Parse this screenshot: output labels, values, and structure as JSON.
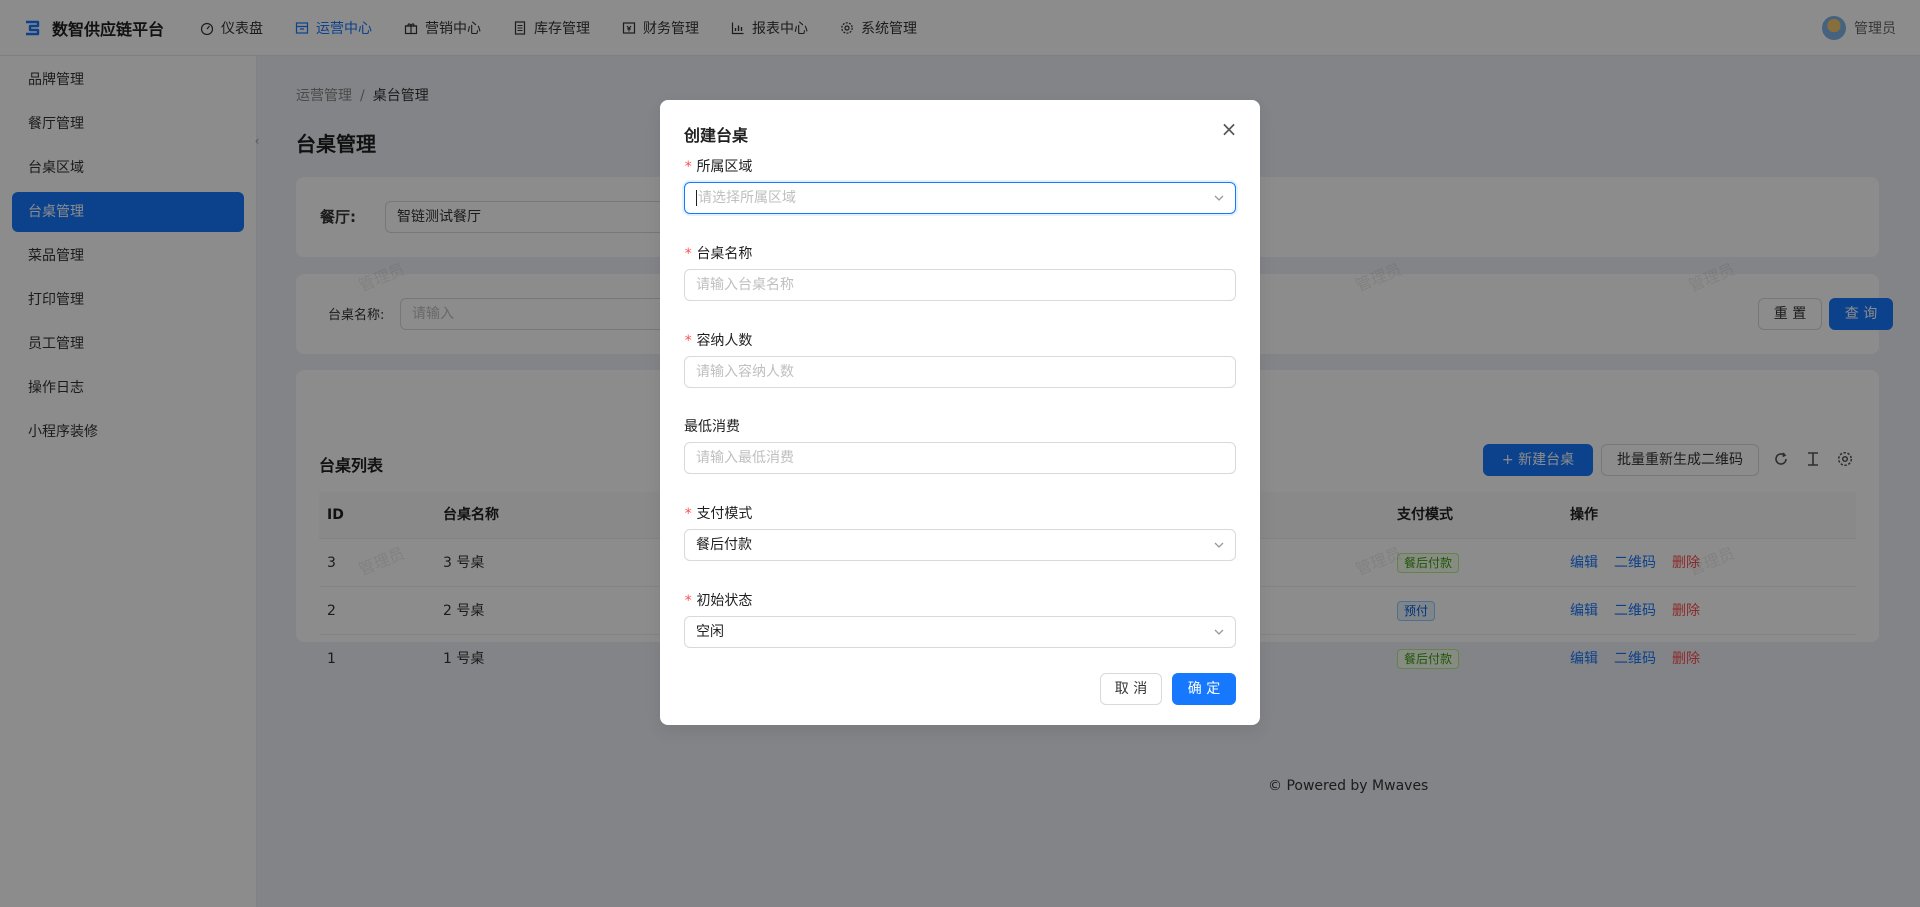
{
  "app": {
    "title": "数智供应链平台",
    "user": "管理员"
  },
  "nav": {
    "items": [
      {
        "label": "仪表盘",
        "icon": "dashboard-icon"
      },
      {
        "label": "运营中心",
        "icon": "shop-icon"
      },
      {
        "label": "营销中心",
        "icon": "gift-icon"
      },
      {
        "label": "库存管理",
        "icon": "file-icon"
      },
      {
        "label": "财务管理",
        "icon": "wallet-icon"
      },
      {
        "label": "报表中心",
        "icon": "chart-icon"
      },
      {
        "label": "系统管理",
        "icon": "gear-icon"
      }
    ],
    "active_index": 1
  },
  "sidebar": {
    "items": [
      {
        "label": "品牌管理"
      },
      {
        "label": "餐厅管理"
      },
      {
        "label": "台桌区域"
      },
      {
        "label": "台桌管理"
      },
      {
        "label": "菜品管理"
      },
      {
        "label": "打印管理"
      },
      {
        "label": "员工管理"
      },
      {
        "label": "操作日志"
      },
      {
        "label": "小程序装修"
      }
    ],
    "active_index": 3
  },
  "breadcrumb": {
    "parent": "运营管理",
    "separator": "/",
    "current": "桌台管理"
  },
  "page": {
    "title": "台桌管理",
    "restaurant_label": "餐厅:",
    "restaurant_value": "智链测试餐厅",
    "search_label": "台桌名称:",
    "search_placeholder": "请输入",
    "reset_button": "重 置",
    "query_button": "查 询",
    "watermark": "管理员",
    "footer": "Powered by Mwaves"
  },
  "table": {
    "title": "台桌列表",
    "new_button": "新建台桌",
    "regen_button": "批量重新生成二维码",
    "columns": [
      "ID",
      "台桌名称",
      "支付模式",
      "操作"
    ],
    "rows": [
      {
        "id": "3",
        "name": "3 号桌",
        "pay_mode": "餐后付款",
        "pay_color": "green"
      },
      {
        "id": "2",
        "name": "2 号桌",
        "pay_mode": "预付",
        "pay_color": "blue"
      },
      {
        "id": "1",
        "name": "1 号桌",
        "pay_mode": "餐后付款",
        "pay_color": "green"
      }
    ],
    "actions": {
      "edit": "编辑",
      "qrcode": "二维码",
      "delete": "删除"
    }
  },
  "modal": {
    "title": "创建台桌",
    "fields": {
      "area": {
        "label": "所属区域",
        "placeholder": "请选择所属区域",
        "required": "*"
      },
      "name": {
        "label": "台桌名称",
        "placeholder": "请输入台桌名称",
        "required": "*"
      },
      "capacity": {
        "label": "容纳人数",
        "placeholder": "请输入容纳人数",
        "required": "*"
      },
      "min_spend": {
        "label": "最低消费",
        "placeholder": "请输入最低消费"
      },
      "pay_mode": {
        "label": "支付模式",
        "value": "餐后付款",
        "required": "*"
      },
      "status": {
        "label": "初始状态",
        "value": "空闲",
        "required": "*"
      }
    },
    "cancel_button": "取 消",
    "ok_button": "确 定"
  },
  "colors": {
    "primary": "#1677ff",
    "danger": "#ff4d4f",
    "success_tag": "#389e0d"
  }
}
